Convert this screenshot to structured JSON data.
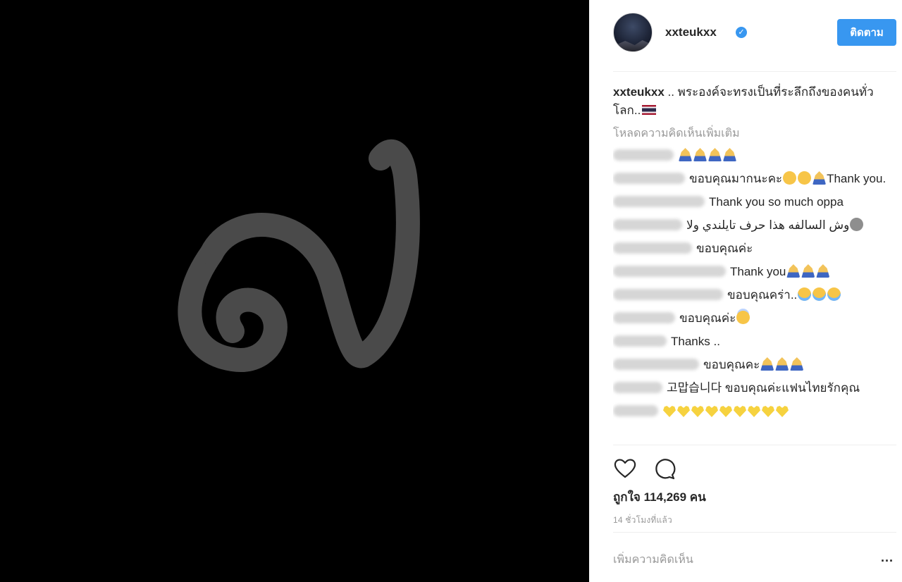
{
  "post": {
    "image_glyph": "๙",
    "image_background": "#000000",
    "glyph_color": "#4a4a4a"
  },
  "header": {
    "avatar_icon": "avatar",
    "username": "xxteukxx",
    "verified_icon": "verified-badge-icon",
    "verified_mark": "✓",
    "follow_label": "ติดตาม"
  },
  "caption": {
    "username": "xxteukxx",
    "text": ".. พระองค์จะทรงเป็นที่ระลึกถึงของคนทั่วโลก..",
    "flag_icon": "thai-flag-icon"
  },
  "load_more": "โหลดความคิดเห็นเพิ่มเติม",
  "comments": [
    {
      "user_blur_width": 86,
      "text": "",
      "emojis": [
        "pray",
        "pray",
        "pray",
        "pray"
      ]
    },
    {
      "user_blur_width": 102,
      "text": "ขอบคุณมากนะคะ",
      "emojis_after": [
        "cry",
        "cry",
        "pray"
      ],
      "tail": "Thank you."
    },
    {
      "user_blur_width": 130,
      "text": "Thank you so much oppa",
      "emojis": []
    },
    {
      "user_blur_width": 98,
      "text": "وش السالفه هذا حرف تايلندي ولا",
      "emojis": [
        "grey"
      ]
    },
    {
      "user_blur_width": 112,
      "text": "ขอบคุณค่ะ",
      "emojis": []
    },
    {
      "user_blur_width": 160,
      "text": "Thank you",
      "emojis": [
        "pray",
        "pray",
        "pray"
      ]
    },
    {
      "user_blur_width": 156,
      "text": "ขอบคุณคร่า..",
      "emojis": [
        "tears",
        "tears",
        "tears"
      ]
    },
    {
      "user_blur_width": 88,
      "text": "ขอบคุณค่ะ",
      "emojis": [
        "angel"
      ]
    },
    {
      "user_blur_width": 76,
      "text": "Thanks ..",
      "emojis": []
    },
    {
      "user_blur_width": 122,
      "text": "ขอบคุณคะ",
      "emojis": [
        "pray",
        "pray",
        "pray"
      ]
    },
    {
      "user_blur_width": 70,
      "text": "고맙습니다 ขอบคุณค่ะแฟนไทยรักคุณ",
      "emojis": []
    },
    {
      "user_blur_width": 64,
      "text": "",
      "emojis": [
        "heart",
        "heart",
        "heart",
        "heart",
        "heart",
        "heart",
        "heart",
        "heart",
        "heart"
      ]
    }
  ],
  "actions": {
    "like_icon": "heart-outline-icon",
    "comment_icon": "comment-bubble-icon"
  },
  "likes": "ถูกใจ 114,269 คน",
  "timestamp": "14 ชั่วโมงที่แล้ว",
  "add_comment_placeholder": "เพิ่มความคิดเห็น",
  "more_options": "...",
  "colors": {
    "accent": "#3897f0",
    "text": "#262626",
    "muted": "#999999",
    "divider": "#efefef"
  }
}
